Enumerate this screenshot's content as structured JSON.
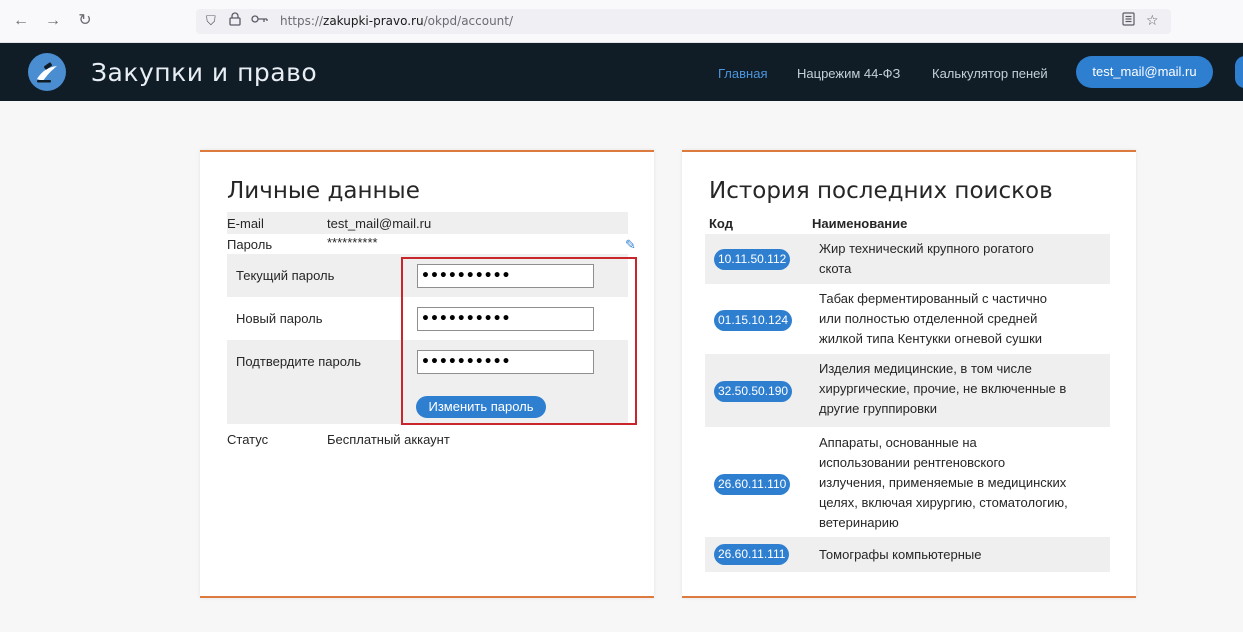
{
  "browser": {
    "url_prefix": "https://",
    "url_domain": "zakupki-pravo.ru",
    "url_path": "/okpd/account/"
  },
  "header": {
    "brand": "Закупки и право",
    "nav": [
      {
        "label": "Главная",
        "active": true
      },
      {
        "label": "Нацрежим 44-ФЗ",
        "active": false
      },
      {
        "label": "Калькулятор пеней",
        "active": false
      }
    ],
    "user_button": "test_mail@mail.ru"
  },
  "personal": {
    "title": "Личные данные",
    "email_label": "E-mail",
    "email_value": "test_mail@mail.ru",
    "password_label": "Пароль",
    "password_value": "**********",
    "current_label": "Текущий пароль",
    "current_value": "••••••••••",
    "new_label": "Новый пароль",
    "new_value": "••••••••••",
    "confirm_label": "Подтвердите пароль",
    "confirm_value": "••••••••••",
    "change_button": "Изменить пароль",
    "status_label": "Статус",
    "status_value": "Бесплатный аккаунт"
  },
  "history": {
    "title": "История последних поисков",
    "col_code": "Код",
    "col_name": "Наименование",
    "rows": [
      {
        "code": "10.11.50.112",
        "lines": [
          "Жир технический крупного рогатого",
          "скота"
        ]
      },
      {
        "code": "01.15.10.124",
        "lines": [
          "Табак ферментированный с частично",
          "или полностью отделенной средней",
          "жилкой типа Кентукки огневой сушки"
        ]
      },
      {
        "code": "32.50.50.190",
        "lines": [
          "Изделия медицинские, в том числе",
          "хирургические, прочие, не включенные в",
          "другие группировки"
        ]
      },
      {
        "code": "26.60.11.110",
        "lines": [
          "Аппараты, основанные на",
          "использовании рентгеновского",
          "излучения, применяемые в медицинских",
          "целях, включая хирургию, стоматологию,",
          "ветеринарию"
        ]
      },
      {
        "code": "26.60.11.111",
        "lines": [
          "Томографы компьютерные"
        ]
      }
    ]
  }
}
